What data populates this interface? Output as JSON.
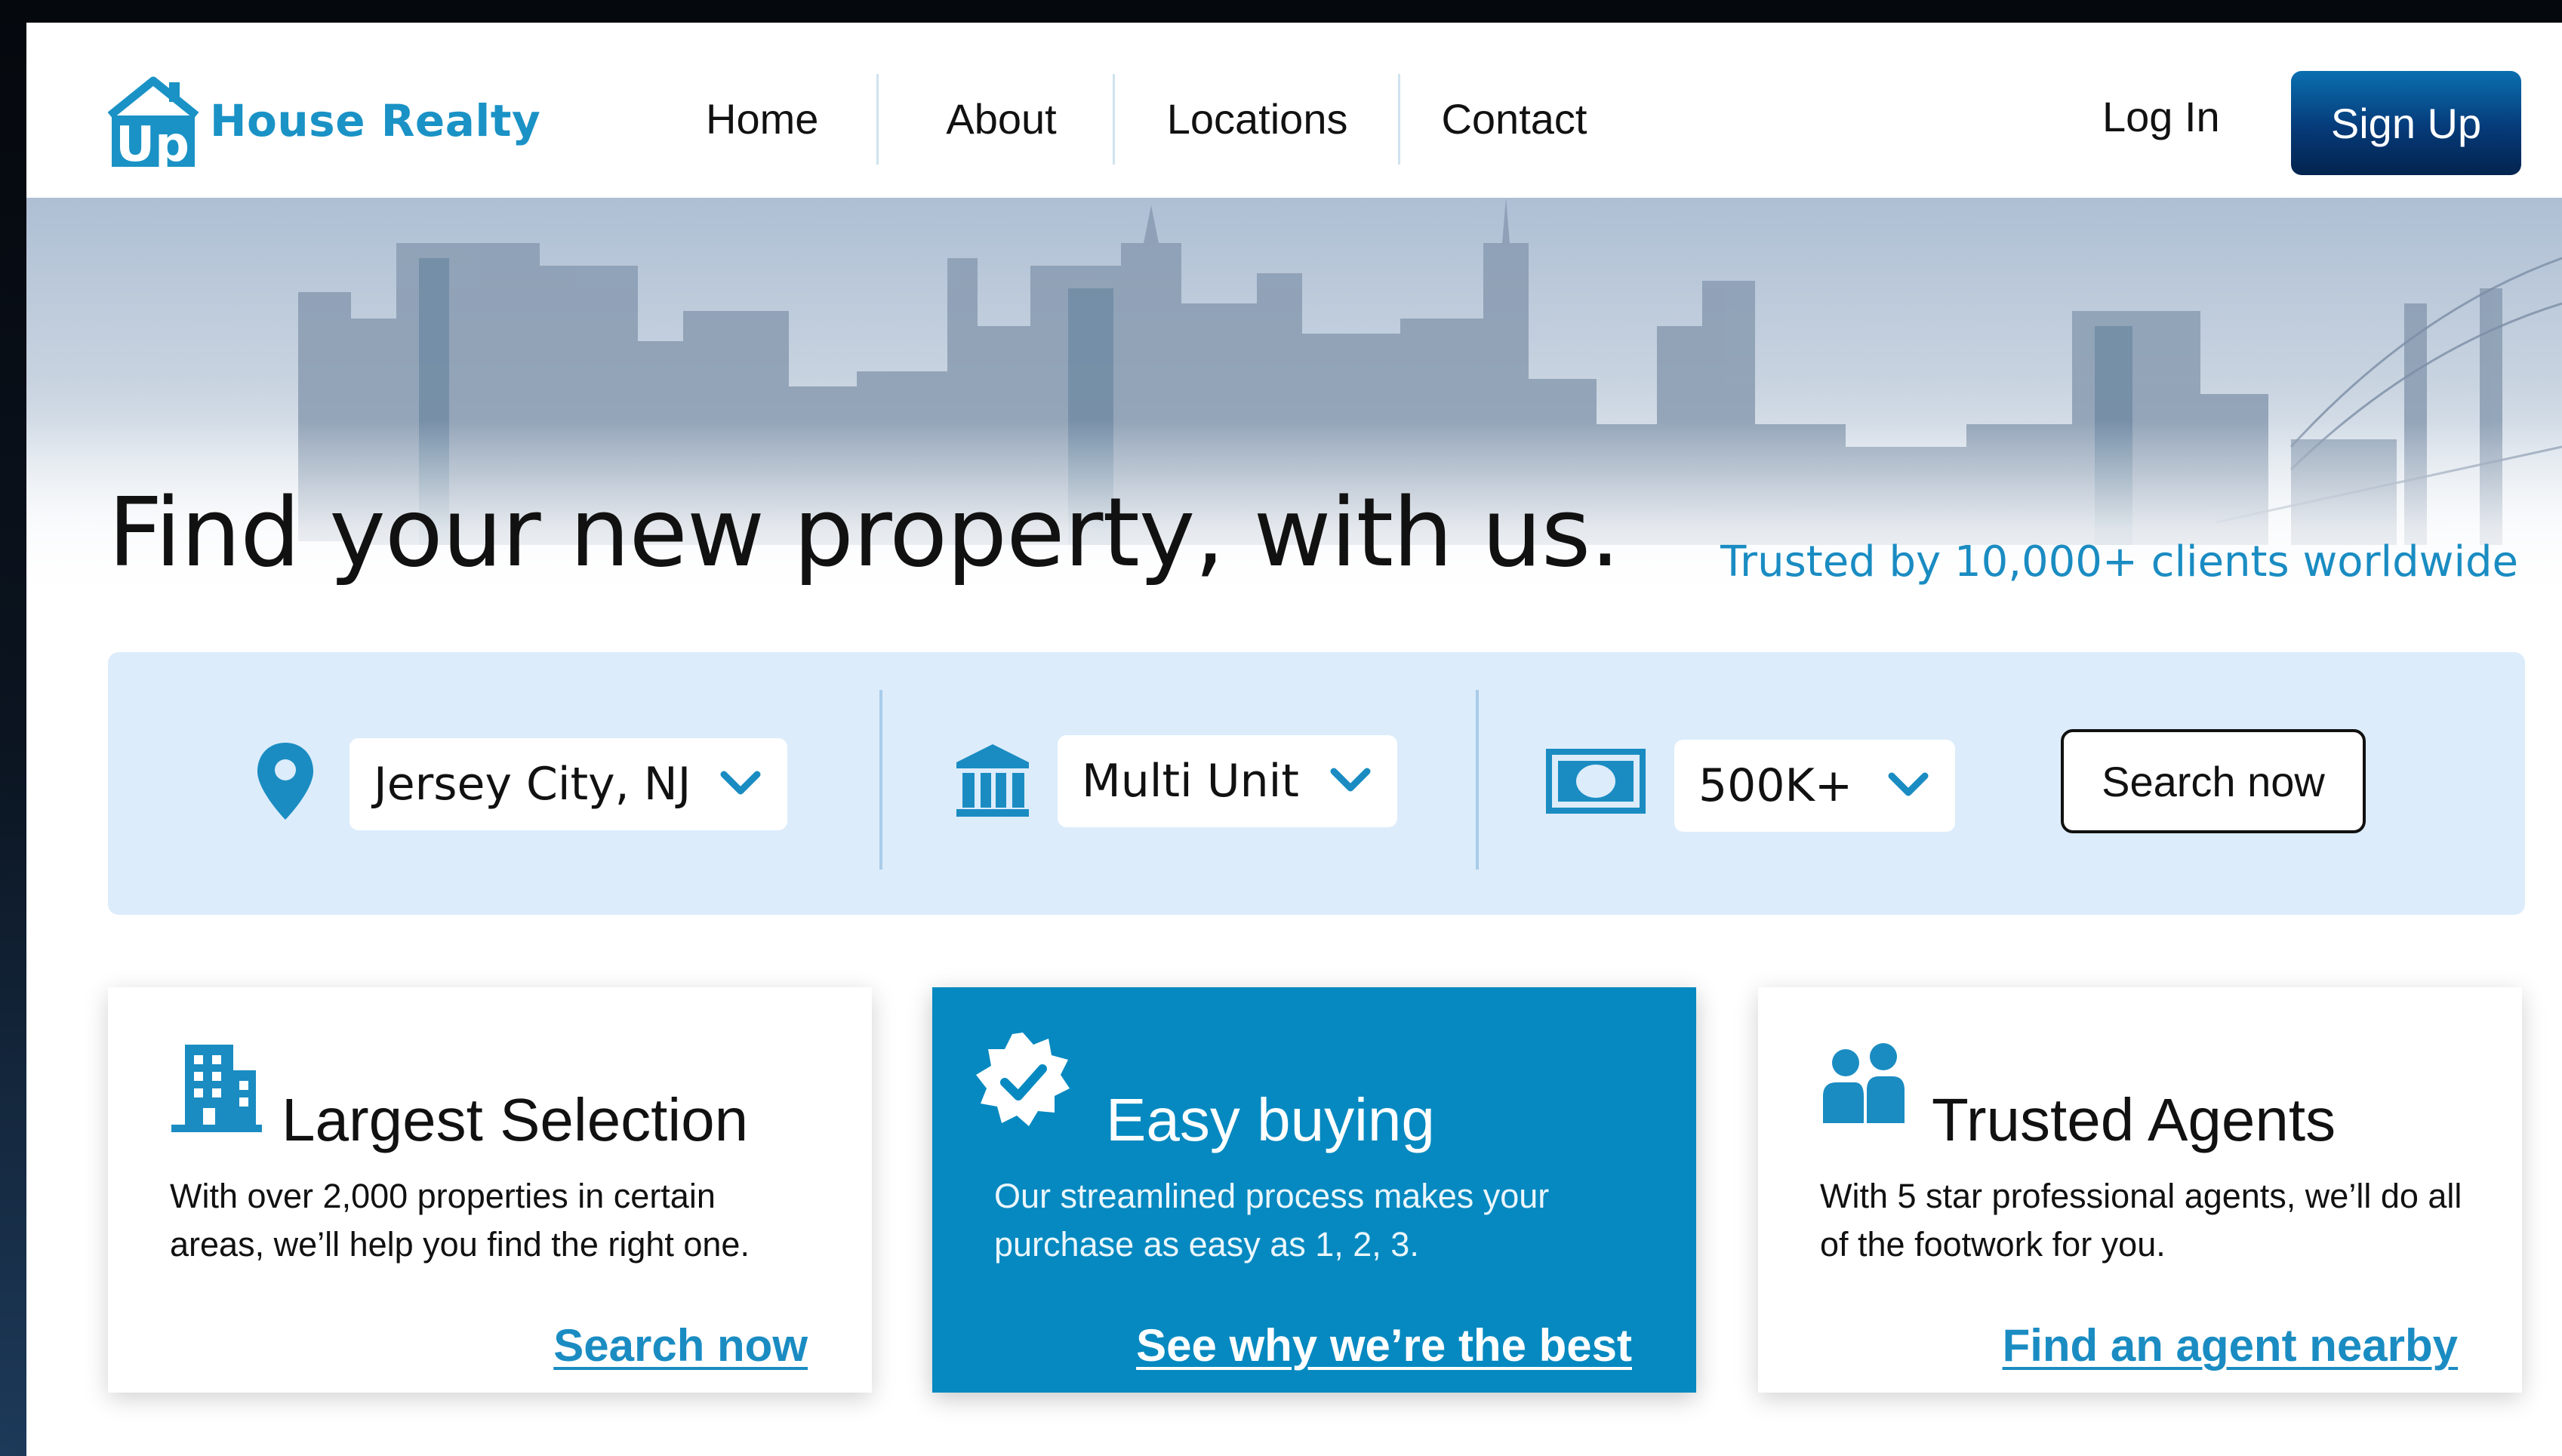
{
  "brand": {
    "logo_mark_text": "Up",
    "name": "House Realty",
    "color": "#1a92c5"
  },
  "nav": {
    "links": [
      "Home",
      "About",
      "Locations",
      "Contact"
    ],
    "login": "Log In",
    "signup": "Sign Up"
  },
  "hero": {
    "title": "Find your new property, with us.",
    "trust": "Trusted by 10,000+ clients worldwide"
  },
  "search": {
    "location": {
      "value": "Jersey City, NJ",
      "icon": "location-pin-icon"
    },
    "property_type": {
      "value": "Multi Unit",
      "icon": "bank-building-icon"
    },
    "price": {
      "value": "500K+",
      "icon": "cash-icon"
    },
    "button": "Search now"
  },
  "cards": [
    {
      "icon": "office-building-icon",
      "title": "Largest Selection",
      "text": "With over 2,000 properties in certain areas, we’ll help you find the right one.",
      "link": "Search now"
    },
    {
      "icon": "verified-badge-icon",
      "title": "Easy buying",
      "text": "Our streamlined process makes your purchase as easy as 1, 2, 3.",
      "link": "See why we’re the best"
    },
    {
      "icon": "people-icon",
      "title": "Trusted Agents",
      "text": "With 5 star professional agents, we’ll do all of the footwork for you.",
      "link": "Find an agent nearby"
    }
  ],
  "colors": {
    "accent": "#1a8cc2",
    "signup_dark": "#063a78",
    "search_bg": "#dcecfb",
    "card_highlight": "#0689c0"
  }
}
